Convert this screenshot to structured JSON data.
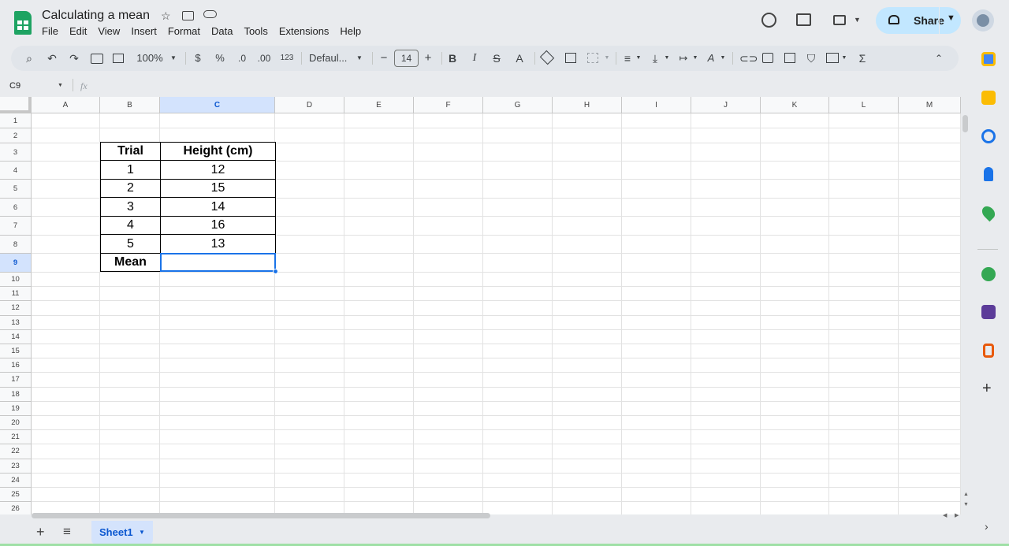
{
  "header": {
    "title": "Calculating a mean",
    "menu": [
      "File",
      "Edit",
      "View",
      "Insert",
      "Format",
      "Data",
      "Tools",
      "Extensions",
      "Help"
    ],
    "share_label": "Share"
  },
  "toolbar": {
    "zoom": "100%",
    "currency": "$",
    "percent": "%",
    "dec_decrease": ".0",
    "dec_increase": ".00",
    "number_format": "123",
    "font": "Defaul...",
    "font_size": "14",
    "bold": "B",
    "italic": "I",
    "strike": "S",
    "text_color": "A",
    "function": "Σ"
  },
  "formula_bar": {
    "name_box": "C9",
    "fx": "fx",
    "formula": ""
  },
  "grid": {
    "columns": [
      "A",
      "B",
      "C",
      "D",
      "E",
      "F",
      "G",
      "H",
      "I",
      "J",
      "K",
      "L",
      "M"
    ],
    "rows": [
      "1",
      "2",
      "3",
      "4",
      "5",
      "6",
      "7",
      "8",
      "9",
      "10",
      "11",
      "12",
      "13",
      "14",
      "15",
      "16",
      "17",
      "18",
      "19",
      "20",
      "21",
      "22",
      "23",
      "24",
      "25",
      "26"
    ],
    "selected_cell": "C9"
  },
  "table": {
    "header": [
      "Trial",
      "Height (cm)"
    ],
    "rows": [
      [
        "1",
        "12"
      ],
      [
        "2",
        "15"
      ],
      [
        "3",
        "14"
      ],
      [
        "4",
        "16"
      ],
      [
        "5",
        "13"
      ]
    ],
    "mean_label": "Mean",
    "mean_value": ""
  },
  "sheets": {
    "tabs": [
      "Sheet1"
    ],
    "active": "Sheet1"
  },
  "colors": {
    "accent": "#1a73e8",
    "share_bg": "#c2e7ff",
    "sheets_green": "#1ea362",
    "text_color_bar": "#d93025"
  }
}
